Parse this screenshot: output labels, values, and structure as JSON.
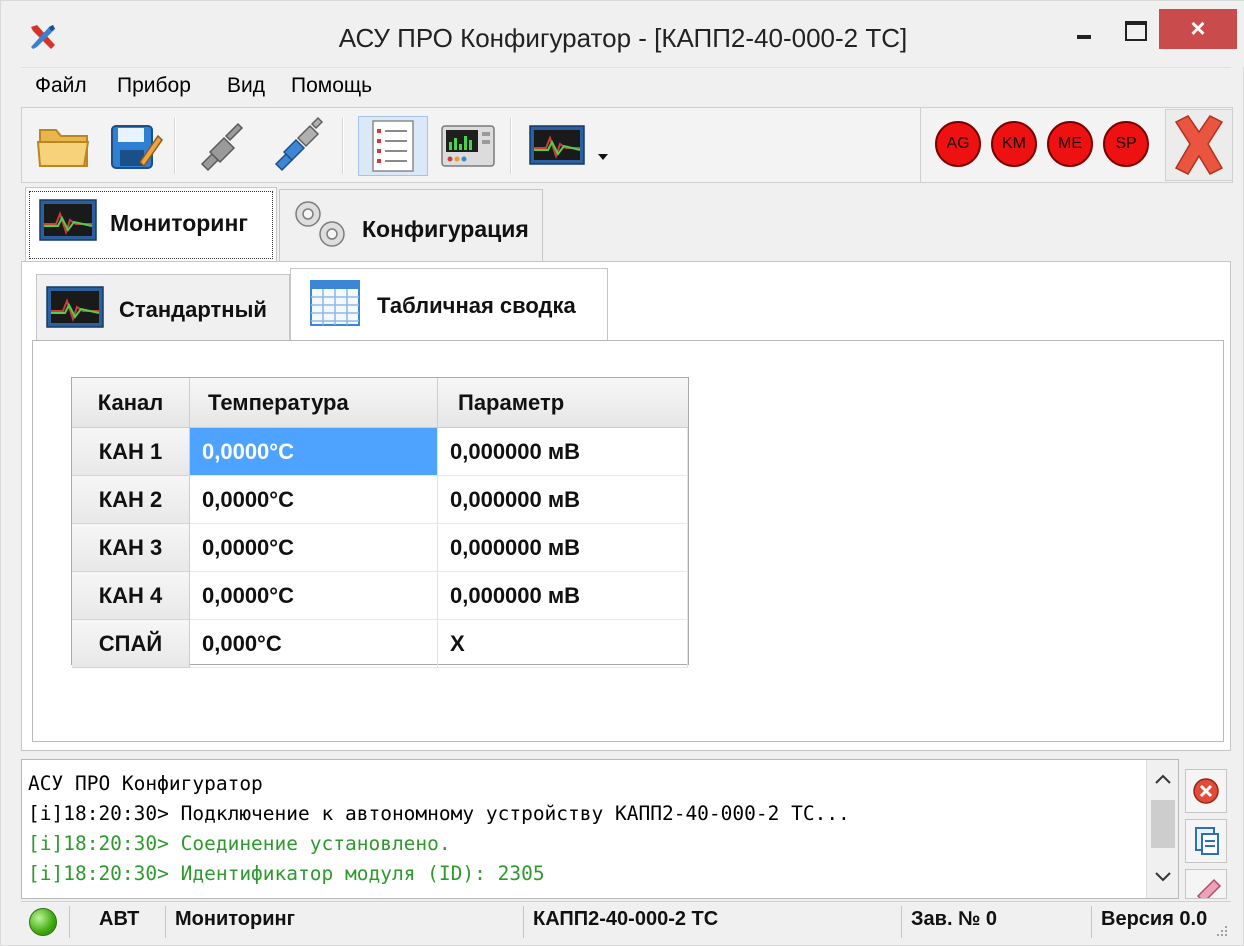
{
  "window": {
    "title": "АСУ ПРО Конфигуратор - [КАПП2-40-000-2 ТС]",
    "close_label": "×"
  },
  "menu": [
    "Файл",
    "Прибор",
    "Вид",
    "Помощь"
  ],
  "toolbar": {
    "icons": [
      "open-folder-icon",
      "save-icon",
      "disconnect-plug-icon",
      "connect-plug-icon",
      "report-list-icon",
      "device-panel-icon",
      "monitor-chart-icon",
      "dropdown-arrow-icon"
    ],
    "indicators": [
      "AG",
      "KM",
      "ME",
      "SP"
    ]
  },
  "tabs": {
    "top": [
      "Мониторинг",
      "Конфигурация"
    ],
    "sub": [
      "Стандартный",
      "Табличная сводка"
    ]
  },
  "table": {
    "headers": [
      "Канал",
      "Температура",
      "Параметр"
    ],
    "rows": [
      {
        "channel": "КАН 1",
        "temp": "0,0000°C",
        "param": "0,000000 мВ"
      },
      {
        "channel": "КАН 2",
        "temp": "0,0000°C",
        "param": "0,000000 мВ"
      },
      {
        "channel": "КАН 3",
        "temp": "0,0000°C",
        "param": "0,000000 мВ"
      },
      {
        "channel": "КАН 4",
        "temp": "0,0000°C",
        "param": "0,000000 мВ"
      },
      {
        "channel": "СПАЙ",
        "temp": "0,000°C",
        "param": "X"
      }
    ]
  },
  "log": {
    "lines": [
      {
        "text": "АСУ ПРО Конфигуратор",
        "color": "#000000"
      },
      {
        "text": "[i]18:20:30> Подключение к автономному устройству КАПП2-40-000-2 ТС...",
        "color": "#000000"
      },
      {
        "text": "[i]18:20:30> Соединение установлено.",
        "color": "#2e9a2e"
      },
      {
        "text": "[i]18:20:30> Идентификатор модуля (ID): 2305",
        "color": "#2e9a2e"
      }
    ]
  },
  "statusbar": {
    "mode": "АВТ",
    "view": "Мониторинг",
    "device": "КАПП2-40-000-2 ТС",
    "serial": "Зав. № 0",
    "version": "Версия 0.0"
  },
  "colors": {
    "selection": "#4da3ff",
    "indicator_red": "#ee1111",
    "log_green": "#2e9a2e",
    "close_button": "#c94b4b"
  }
}
